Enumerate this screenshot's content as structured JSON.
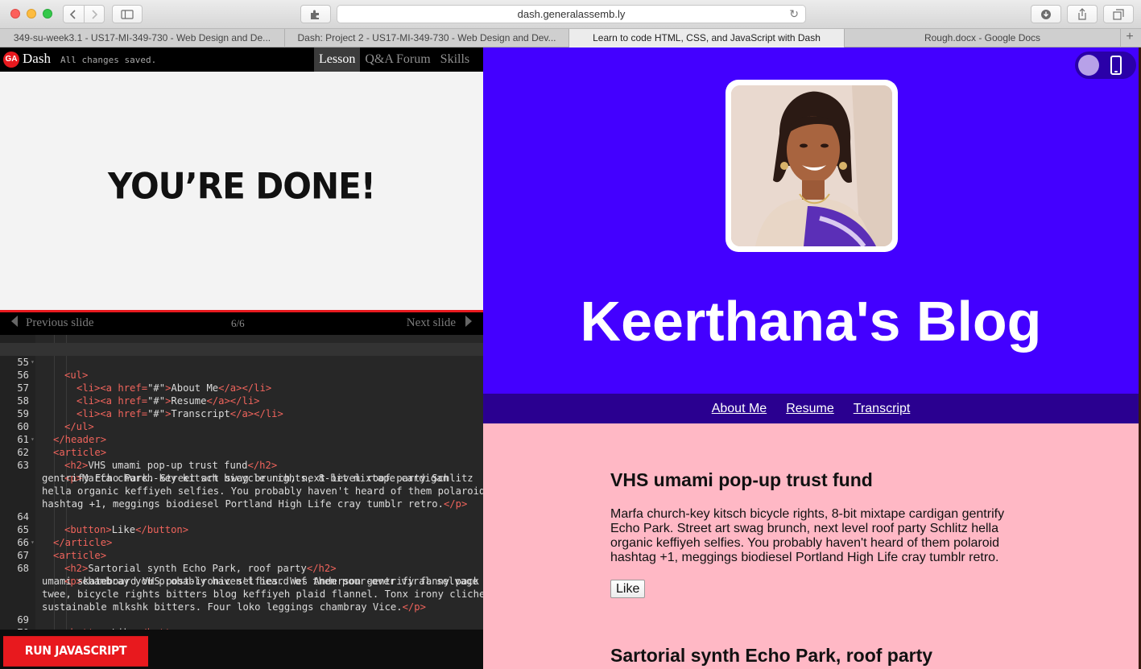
{
  "browser": {
    "url": "dash.generalassemb.ly",
    "tabs": [
      {
        "label": "349-su-week3.1 - US17-MI-349-730 - Web Design and De..."
      },
      {
        "label": "Dash: Project 2 - US17-MI-349-730 - Web Design and Dev..."
      },
      {
        "label": "Learn to code HTML, CSS, and JavaScript with Dash"
      },
      {
        "label": "Rough.docx - Google Docs"
      }
    ]
  },
  "dash": {
    "logo": "GA",
    "title": "Dash",
    "status": "All changes saved.",
    "tabs": [
      {
        "label": "Lesson"
      },
      {
        "label": "Q&A Forum"
      },
      {
        "label": "Skills"
      }
    ],
    "slide_heading": "YOU’RE DONE!",
    "prev_label": "Previous slide",
    "next_label": "Next slide",
    "counter": "6/6",
    "run_label": "RUN JAVASCRIPT"
  },
  "editor": {
    "lines": [
      {
        "n": "55",
        "fold": true
      },
      {
        "n": "56"
      },
      {
        "n": "57"
      },
      {
        "n": "58"
      },
      {
        "n": "59"
      },
      {
        "n": "60"
      },
      {
        "n": "61",
        "fold": true
      },
      {
        "n": "62"
      },
      {
        "n": "63"
      },
      {
        "n": ""
      },
      {
        "n": ""
      },
      {
        "n": ""
      },
      {
        "n": "64"
      },
      {
        "n": "65"
      },
      {
        "n": "66",
        "fold": true
      },
      {
        "n": "67"
      },
      {
        "n": "68"
      },
      {
        "n": ""
      },
      {
        "n": ""
      },
      {
        "n": ""
      },
      {
        "n": "69"
      },
      {
        "n": "70"
      }
    ],
    "text": {
      "about": "About Me",
      "resume": "Resume",
      "transcript": "Transcript",
      "h2_1": "VHS umami pop-up trust fund",
      "p1_a": "Marfa church-key kitsch bicycle rights, 8-bit mixtape cardigan",
      "p1_b": "gentrify Echo Park. Street art swag brunch, next level roof party Schlitz",
      "p1_c": "hella organic keffiyeh selfies. You probably haven't heard of them polaroid",
      "p1_d": "hashtag +1, meggings biodiesel Portland High Life cray tumblr retro.",
      "like": "Like",
      "h2_2": "Sartorial synth Echo Park, roof party",
      "p2_a": "chambray you probably haven't heard of them pour-over viral selvage",
      "p2_b": "umami skateboard VHS post-ironic selfies. Wes Anderson gentrify fanny pack",
      "p2_c": "twee, bicycle rights bitters blog keffiyeh plaid flannel. Tonx irony cliche",
      "p2_d": "sustainable mlkshk bitters. Four loko leggings chambray Vice."
    }
  },
  "preview": {
    "blog_title": "Keerthana's Blog",
    "nav": [
      {
        "label": "About Me"
      },
      {
        "label": "Resume"
      },
      {
        "label": "Transcript"
      }
    ],
    "articles": [
      {
        "title": "VHS umami pop-up trust fund",
        "body": "Marfa church-key kitsch bicycle rights, 8-bit mixtape cardigan gentrify Echo Park. Street art swag brunch, next level roof party Schlitz hella organic keffiyeh selfies. You probably haven't heard of them polaroid hashtag +1, meggings biodiesel Portland High Life cray tumblr retro.",
        "button": "Like"
      },
      {
        "title": "Sartorial synth Echo Park, roof party"
      }
    ],
    "colors": {
      "hero": "#4300ff",
      "nav": "#2a0090",
      "body": "#ffb8c5"
    }
  }
}
